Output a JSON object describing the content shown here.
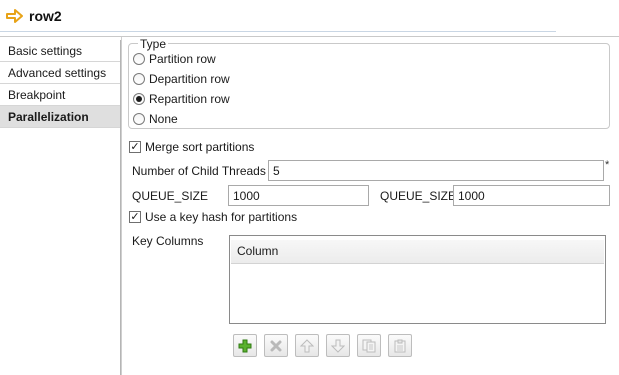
{
  "header": {
    "title": "row2",
    "icon": "arrow-right-icon",
    "accent": "#e8a317"
  },
  "sidebar": {
    "items": [
      {
        "label": "Basic settings",
        "active": false
      },
      {
        "label": "Advanced settings",
        "active": false
      },
      {
        "label": "Breakpoint",
        "active": false
      },
      {
        "label": "Parallelization",
        "active": true
      }
    ]
  },
  "type_group": {
    "legend": "Type",
    "options": [
      {
        "label": "Partition row",
        "selected": false
      },
      {
        "label": "Departition row",
        "selected": false
      },
      {
        "label": "Repartition row",
        "selected": true
      },
      {
        "label": "None",
        "selected": false
      }
    ]
  },
  "merge_sort": {
    "label": "Merge sort partitions",
    "checked": true
  },
  "child_threads": {
    "label": "Number of Child Threads",
    "value": "5",
    "required_mark": "*"
  },
  "queue": [
    {
      "label": "QUEUE_SIZE",
      "value": "1000"
    },
    {
      "label": "QUEUE_SIZE",
      "value": "1000"
    }
  ],
  "key_hash": {
    "label": "Use a key hash for partitions",
    "checked": true
  },
  "key_columns": {
    "label": "Key Columns",
    "column_header": "Column",
    "rows": []
  },
  "toolbar": {
    "buttons": [
      {
        "name": "add-button",
        "icon": "plus-icon",
        "enabled": true
      },
      {
        "name": "delete-button",
        "icon": "x-icon",
        "enabled": false
      },
      {
        "name": "move-up-button",
        "icon": "arrow-up-icon",
        "enabled": false
      },
      {
        "name": "move-down-button",
        "icon": "arrow-down-icon",
        "enabled": false
      },
      {
        "name": "copy-button",
        "icon": "copy-icon",
        "enabled": false
      },
      {
        "name": "paste-button",
        "icon": "paste-icon",
        "enabled": false
      }
    ]
  }
}
